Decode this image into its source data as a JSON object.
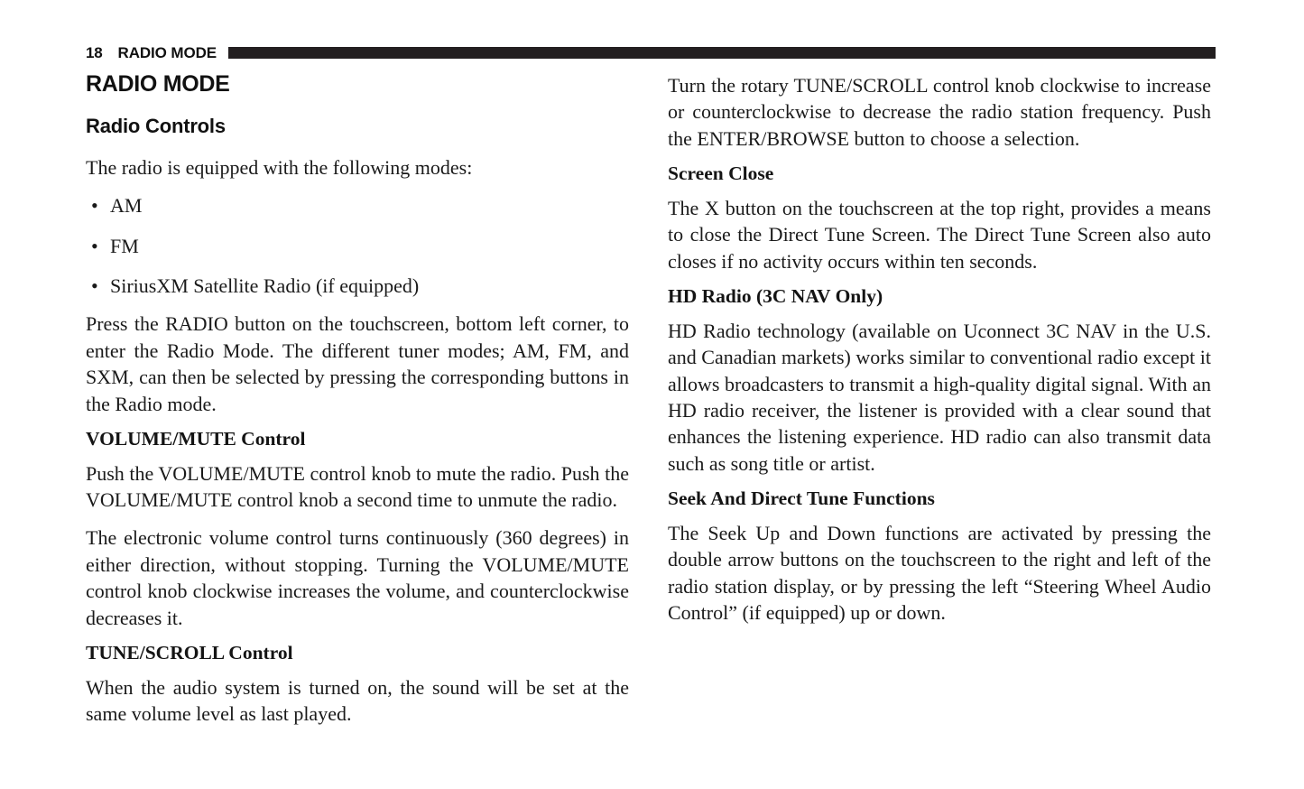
{
  "page": {
    "folio": "18",
    "running_head": "RADIO MODE",
    "rule_color": "#231f20",
    "background_color": "#ffffff",
    "text_color": "#1a1a1a"
  },
  "left_column": {
    "title": "RADIO MODE",
    "section_heading": "Radio Controls",
    "intro": "The radio is equipped with the following modes:",
    "modes": [
      {
        "bullet": "•",
        "label": "AM"
      },
      {
        "bullet": "•",
        "label": "FM"
      },
      {
        "bullet": "•",
        "label": "SiriusXM Satellite Radio (if equipped)"
      }
    ],
    "radio_mode_paragraph": "Press the RADIO button on the touchscreen, bottom left corner, to enter the Radio Mode. The different tuner modes; AM, FM, and SXM, can then be selected by pressing the corresponding buttons in the Radio mode.",
    "volume_mute_heading": "VOLUME/MUTE Control",
    "volume_mute_paragraph_1": "Push the VOLUME/MUTE control knob to mute the radio. Push the VOLUME/MUTE control knob a second time to unmute the radio.",
    "volume_mute_paragraph_2": "The electronic volume control turns continuously (360 degrees) in either direction, without stopping. Turning the VOLUME/MUTE control knob clockwise increases the volume, and counterclockwise decreases it.",
    "tune_scroll_heading": "TUNE/SCROLL Control",
    "tune_scroll_paragraph": "When the audio system is turned on, the sound will be set at the same volume level as last played."
  },
  "right_column": {
    "tune_scroll_continued": "Turn the rotary TUNE/SCROLL control knob clockwise to increase or counterclockwise to decrease the radio station frequency. Push the ENTER/BROWSE button to choose a selection.",
    "screen_close_heading": "Screen Close",
    "screen_close_paragraph": "The X button on the touchscreen at the top right, provides a means to close the Direct Tune Screen. The Direct Tune Screen also auto closes if no activity occurs within ten seconds.",
    "hd_radio_heading": "HD Radio (3C NAV Only)",
    "hd_radio_paragraph": "HD Radio technology (available on Uconnect 3C NAV in the U.S. and Canadian markets) works similar to conventional radio except it allows broadcasters to transmit a high-quality digital signal. With an HD radio receiver, the listener is provided with a clear sound that enhances the listening experience. HD radio can also transmit data such as song title or artist.",
    "seek_heading": "Seek And Direct Tune Functions",
    "seek_paragraph": "The Seek Up and Down functions are activated by pressing the double arrow buttons on the touchscreen to the right and left of the radio station display, or by pressing the left “Steering Wheel Audio Control” (if equipped) up or down."
  }
}
